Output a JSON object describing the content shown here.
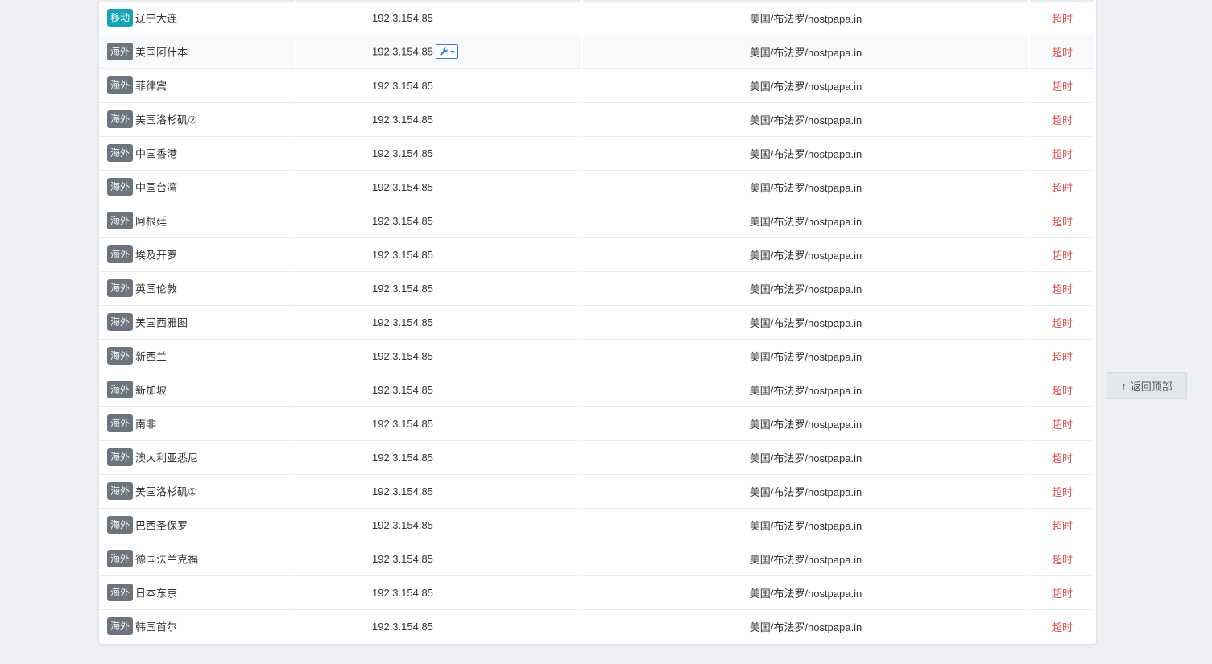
{
  "rows": [
    {
      "tag": "移动",
      "tag_type": "mobile",
      "node": "辽宁大连",
      "ip": "192.3.154.85",
      "location": "美国/布法罗/hostpapa.in",
      "status": "超时"
    },
    {
      "tag": "海外",
      "tag_type": "oversea",
      "node": "美国阿什本",
      "ip": "192.3.154.85",
      "location": "美国/布法罗/hostpapa.in",
      "status": "超时",
      "tool": true
    },
    {
      "tag": "海外",
      "tag_type": "oversea",
      "node": "菲律宾",
      "ip": "192.3.154.85",
      "location": "美国/布法罗/hostpapa.in",
      "status": "超时"
    },
    {
      "tag": "海外",
      "tag_type": "oversea",
      "node": "美国洛杉矶②",
      "ip": "192.3.154.85",
      "location": "美国/布法罗/hostpapa.in",
      "status": "超时"
    },
    {
      "tag": "海外",
      "tag_type": "oversea",
      "node": "中国香港",
      "ip": "192.3.154.85",
      "location": "美国/布法罗/hostpapa.in",
      "status": "超时"
    },
    {
      "tag": "海外",
      "tag_type": "oversea",
      "node": "中国台湾",
      "ip": "192.3.154.85",
      "location": "美国/布法罗/hostpapa.in",
      "status": "超时"
    },
    {
      "tag": "海外",
      "tag_type": "oversea",
      "node": "阿根廷",
      "ip": "192.3.154.85",
      "location": "美国/布法罗/hostpapa.in",
      "status": "超时"
    },
    {
      "tag": "海外",
      "tag_type": "oversea",
      "node": "埃及开罗",
      "ip": "192.3.154.85",
      "location": "美国/布法罗/hostpapa.in",
      "status": "超时"
    },
    {
      "tag": "海外",
      "tag_type": "oversea",
      "node": "英国伦敦",
      "ip": "192.3.154.85",
      "location": "美国/布法罗/hostpapa.in",
      "status": "超时"
    },
    {
      "tag": "海外",
      "tag_type": "oversea",
      "node": "美国西雅图",
      "ip": "192.3.154.85",
      "location": "美国/布法罗/hostpapa.in",
      "status": "超时"
    },
    {
      "tag": "海外",
      "tag_type": "oversea",
      "node": "新西兰",
      "ip": "192.3.154.85",
      "location": "美国/布法罗/hostpapa.in",
      "status": "超时"
    },
    {
      "tag": "海外",
      "tag_type": "oversea",
      "node": "新加坡",
      "ip": "192.3.154.85",
      "location": "美国/布法罗/hostpapa.in",
      "status": "超时"
    },
    {
      "tag": "海外",
      "tag_type": "oversea",
      "node": "南非",
      "ip": "192.3.154.85",
      "location": "美国/布法罗/hostpapa.in",
      "status": "超时"
    },
    {
      "tag": "海外",
      "tag_type": "oversea",
      "node": "澳大利亚悉尼",
      "ip": "192.3.154.85",
      "location": "美国/布法罗/hostpapa.in",
      "status": "超时"
    },
    {
      "tag": "海外",
      "tag_type": "oversea",
      "node": "美国洛杉矶①",
      "ip": "192.3.154.85",
      "location": "美国/布法罗/hostpapa.in",
      "status": "超时"
    },
    {
      "tag": "海外",
      "tag_type": "oversea",
      "node": "巴西圣保罗",
      "ip": "192.3.154.85",
      "location": "美国/布法罗/hostpapa.in",
      "status": "超时"
    },
    {
      "tag": "海外",
      "tag_type": "oversea",
      "node": "德国法兰克福",
      "ip": "192.3.154.85",
      "location": "美国/布法罗/hostpapa.in",
      "status": "超时"
    },
    {
      "tag": "海外",
      "tag_type": "oversea",
      "node": "日本东京",
      "ip": "192.3.154.85",
      "location": "美国/布法罗/hostpapa.in",
      "status": "超时"
    },
    {
      "tag": "海外",
      "tag_type": "oversea",
      "node": "韩国首尔",
      "ip": "192.3.154.85",
      "location": "美国/布法罗/hostpapa.in",
      "status": "超时"
    }
  ],
  "tool_icon": "wrench-icon",
  "back_to_top": {
    "arrow": "↑",
    "label": "返回顶部"
  },
  "colors": {
    "mobile_badge": "#17a2b8",
    "oversea_badge": "#6c757d",
    "timeout": "#e05454",
    "tool_accent": "#2f7fd8"
  }
}
